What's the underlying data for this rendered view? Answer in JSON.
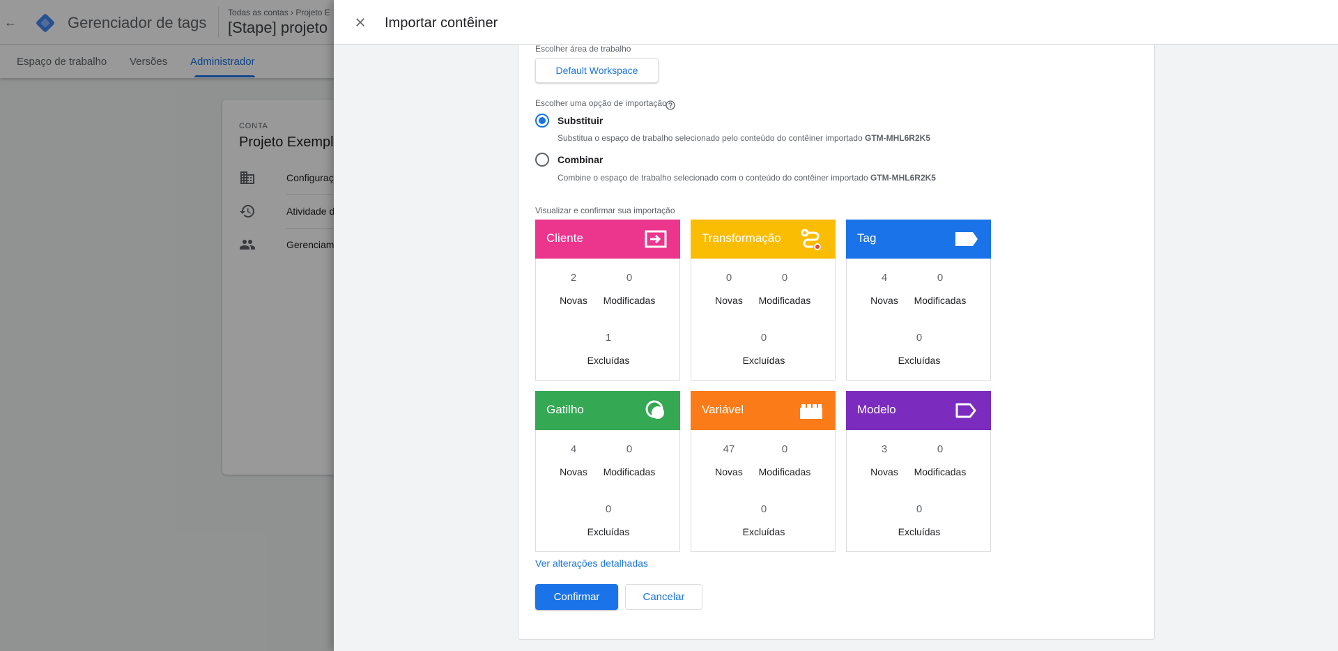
{
  "background": {
    "product_name": "Gerenciador de tags",
    "breadcrumb": "Todas as contas  ›  Projeto E",
    "container_name": "[Stape] projeto",
    "tabs": [
      {
        "label": "Espaço de trabalho",
        "active": false
      },
      {
        "label": "Versões",
        "active": false
      },
      {
        "label": "Administrador",
        "active": true
      }
    ],
    "account_card": {
      "section_label": "CONTA",
      "title": "Projeto Exempl",
      "items": [
        {
          "label": "Configurações",
          "icon": "building-icon"
        },
        {
          "label": "Atividade da C",
          "icon": "history-icon"
        },
        {
          "label": "Gerenciament",
          "icon": "people-icon"
        }
      ]
    }
  },
  "sheet": {
    "title": "Importar contêiner",
    "workspace_label": "Escolher área de trabalho",
    "workspace_button": "Default Workspace",
    "import_option_label": "Escolher uma opção de importação",
    "options": [
      {
        "title": "Substituir",
        "desc_prefix": "Substitua o espaço de trabalho selecionado pelo conteúdo do contêiner importado ",
        "container_id": "GTM-MHL6R2K5",
        "selected": true
      },
      {
        "title": "Combinar",
        "desc_prefix": "Combine o espaço de trabalho selecionado com o conteúdo do contêiner importado ",
        "container_id": "GTM-MHL6R2K5",
        "selected": false
      }
    ],
    "preview_label": "Visualizar e confirmar sua importação",
    "captions": {
      "new": "Novas",
      "modified": "Modificadas",
      "deleted": "Excluídas"
    },
    "tiles": [
      {
        "name": "Cliente",
        "color": "#ec368d",
        "icon": "client-icon",
        "new": "2",
        "modified": "0",
        "deleted": "1"
      },
      {
        "name": "Transformação",
        "color": "#fbbc04",
        "icon": "transformation-icon",
        "new": "0",
        "modified": "0",
        "deleted": "0"
      },
      {
        "name": "Tag",
        "color": "#1a73e8",
        "icon": "tag-icon",
        "new": "4",
        "modified": "0",
        "deleted": "0"
      },
      {
        "name": "Gatilho",
        "color": "#34a853",
        "icon": "trigger-icon",
        "new": "4",
        "modified": "0",
        "deleted": "0"
      },
      {
        "name": "Variável",
        "color": "#fa7b17",
        "icon": "variable-icon",
        "new": "47",
        "modified": "0",
        "deleted": "0"
      },
      {
        "name": "Modelo",
        "color": "#7b2cbf",
        "icon": "template-icon",
        "new": "3",
        "modified": "0",
        "deleted": "0"
      }
    ],
    "details_link": "Ver alterações detalhadas",
    "confirm_button": "Confirmar",
    "cancel_button": "Cancelar"
  }
}
